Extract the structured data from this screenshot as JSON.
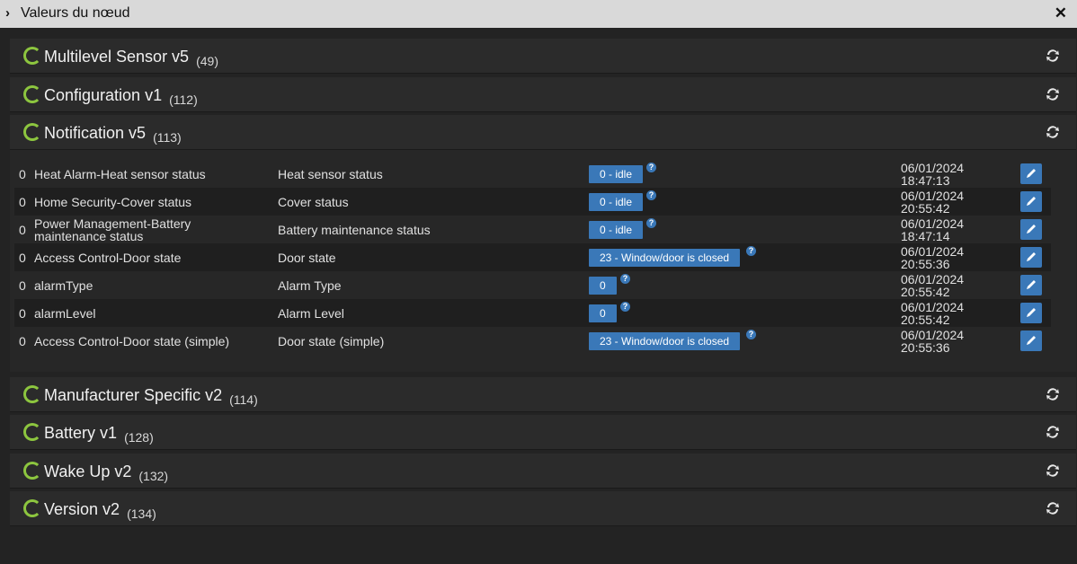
{
  "window": {
    "title": "Valeurs du nœud"
  },
  "panels": [
    {
      "name": "Multilevel Sensor v5",
      "count": "(49)"
    },
    {
      "name": "Configuration v1",
      "count": "(112)"
    },
    {
      "name": "Notification v5",
      "count": "(113)"
    },
    {
      "name": "Manufacturer Specific v2",
      "count": "(114)"
    },
    {
      "name": "Battery v1",
      "count": "(128)"
    },
    {
      "name": "Wake Up v2",
      "count": "(132)"
    },
    {
      "name": "Version v2",
      "count": "(134)"
    }
  ],
  "rows": [
    {
      "instance": "0",
      "label": "Heat Alarm-Heat sensor status",
      "help": "Heat sensor status",
      "value": "0 - idle",
      "date": "06/01/2024",
      "time": "18:47:13"
    },
    {
      "instance": "0",
      "label": "Home Security-Cover status",
      "help": "Cover status",
      "value": "0 - idle",
      "date": "06/01/2024",
      "time": "20:55:42"
    },
    {
      "instance": "0",
      "label": "Power Management-Battery maintenance status",
      "help": "Battery maintenance status",
      "value": "0 - idle",
      "date": "06/01/2024",
      "time": "18:47:14"
    },
    {
      "instance": "0",
      "label": "Access Control-Door state",
      "help": "Door state",
      "value": "23 - Window/door is closed",
      "date": "06/01/2024",
      "time": "20:55:36"
    },
    {
      "instance": "0",
      "label": "alarmType",
      "help": "Alarm Type",
      "value": "0",
      "date": "06/01/2024",
      "time": "20:55:42"
    },
    {
      "instance": "0",
      "label": "alarmLevel",
      "help": "Alarm Level",
      "value": "0",
      "date": "06/01/2024",
      "time": "20:55:42"
    },
    {
      "instance": "0",
      "label": "Access Control-Door state (simple)",
      "help": "Door state (simple)",
      "value": "23 - Window/door is closed",
      "date": "06/01/2024",
      "time": "20:55:36"
    }
  ],
  "icons": {
    "expand": "chevron-right-icon",
    "close": "close-icon",
    "status": "loading-ring-icon",
    "refresh": "refresh-icon",
    "help": "question-icon",
    "edit": "pencil-icon"
  },
  "colors": {
    "accent": "#3a78b8",
    "status_ring": "#8dc63f",
    "background": "#232323",
    "titlebar": "#d9d9d9"
  }
}
